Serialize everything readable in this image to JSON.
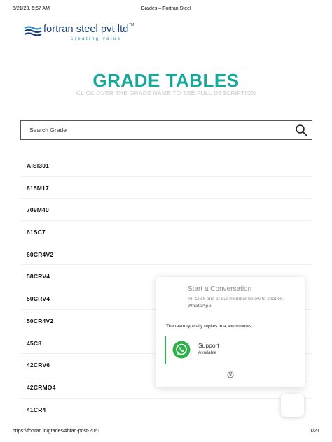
{
  "print_header": {
    "datetime": "5/21/23, 5:57 AM",
    "title": "Grades – Fortran Steel"
  },
  "logo": {
    "name": "fortran steel pvt ltd",
    "trademark": "TM",
    "tagline": "creating value"
  },
  "hero": {
    "title": "GRADE TABLES",
    "subtitle": "CLICK OVER THE GRADE NAME TO SEE FULL DESCRIPTION"
  },
  "search": {
    "placeholder": "Search Grade"
  },
  "grades": [
    "AISI301",
    "815M17",
    "709M40",
    "61SC7",
    "60CR4V2",
    "58CRV4",
    "50CRV4",
    "50CR4V2",
    "45C8",
    "42CRV6",
    "42CRMO4",
    "41CR4"
  ],
  "chat": {
    "title": "Start a Conversation",
    "text": "Hi! Click one of our member below to chat on",
    "app": "WhatsApp",
    "reply_note": "The team typically replies in a few minutes.",
    "agent_name": "Support",
    "agent_status": "Available"
  },
  "print_footer": {
    "url": "https://fortran.in/grades/#hfaq-post-2061",
    "page": "1/21"
  },
  "colors": {
    "accent": "#17a89a",
    "brand": "#1b3f7a",
    "whatsapp": "#2fb04b"
  }
}
